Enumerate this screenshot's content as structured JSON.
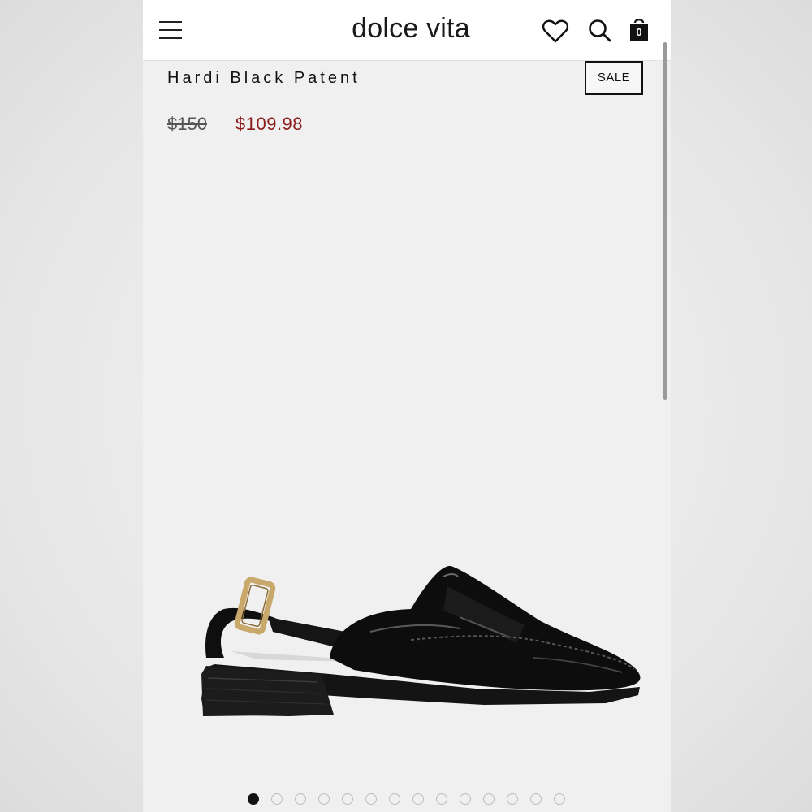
{
  "header": {
    "brand": "dolce vita",
    "menu_icon": "hamburger-menu-icon",
    "wishlist_icon": "heart-icon",
    "search_icon": "search-icon",
    "bag_icon": "shopping-bag-icon",
    "bag_count": "0"
  },
  "product": {
    "name": "Hardi Black Patent",
    "badge": "SALE",
    "original_price": "$150",
    "sale_price": "$109.98",
    "image_subject": "shoe-image"
  },
  "gallery": {
    "total_images": 14,
    "active_index": 0
  },
  "colors": {
    "sale_price": "#8b1a1a",
    "background": "#f1f0f0",
    "header": "#ffffff"
  }
}
